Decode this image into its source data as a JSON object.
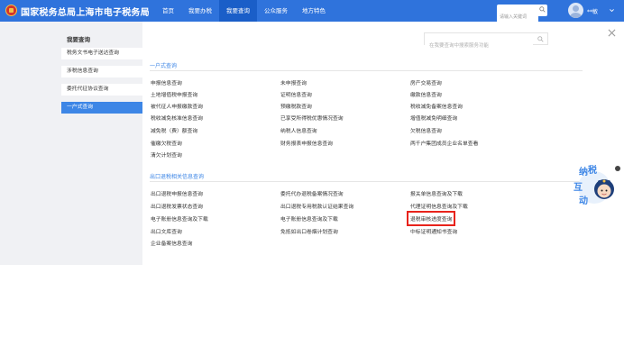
{
  "header": {
    "site_title": "国家税务总局上海市电子税务局",
    "nav": [
      "首页",
      "我要办税",
      "我要查询",
      "公众服务",
      "地方特色"
    ],
    "active_nav": 2,
    "search_placeholder": "请输入关键词",
    "user_name": "**敏"
  },
  "sidebar": {
    "title": "我要查询",
    "items": [
      "税务文书电子送达查询",
      "涉税信息查询",
      "委托代征协议查询",
      "一户式查询"
    ],
    "active_index": 3
  },
  "panel": {
    "search_placeholder": "在我要查询中搜索服务功能",
    "sections": [
      {
        "title": "一户式查询",
        "columns": [
          [
            "申报信息查询",
            "土地增值税申报查询",
            "被代征人申报缴款查询",
            "税收减免核准信息查询",
            "减免税（费）额查询",
            "催缴欠税查询",
            "清欠计划查询"
          ],
          [
            "未申报查询",
            "证明信息查询",
            "预缴税款查询",
            "已享受所得税优惠情况查询",
            "纳税人信息查询",
            "财务报表申报信息查询"
          ],
          [
            "房产交易查询",
            "缴款信息查询",
            "税收减免备案信息查询",
            "增值税减免明细查询",
            "欠税信息查询",
            "两千户集团成员企业名单查看"
          ]
        ]
      },
      {
        "title": "出口退税相关信息查询",
        "columns": [
          [
            "出口退税申报信息查询",
            "出口退税发票状态查询",
            "电子账册信息查询及下载",
            "出口文库查询",
            "企业备案信息查询"
          ],
          [
            "委托代办退税备案情况查询",
            "出口退税专用税款认证结果查询",
            "电子账册信息查询及下载",
            "免抵如出口卷烟计划查询"
          ],
          [
            "报关单信息查询及下载",
            "代理证明信息查询及下载",
            "退税审核进度查询",
            "中标证明通知书查询"
          ]
        ]
      }
    ],
    "highlighted_link": "退税审核进度查询"
  },
  "helper": {
    "chars": [
      "纳",
      "税",
      "互",
      "动"
    ]
  },
  "colors": {
    "topbar": "#2f73dc",
    "active_nav": "#1a5ec8",
    "accent": "#3d86e6",
    "highlight_box": "#e8231b"
  }
}
